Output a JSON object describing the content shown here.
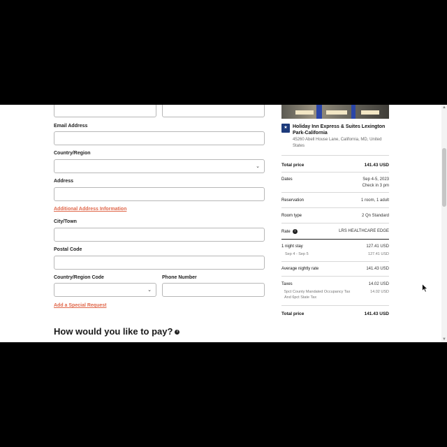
{
  "form": {
    "email_label": "Email Address",
    "country_label": "Country/Region",
    "address_label": "Address",
    "additional_address_link": "Additional Address Information",
    "city_label": "City/Town",
    "postal_label": "Postal Code",
    "country_code_label": "Country/Region Code",
    "phone_label": "Phone Number",
    "special_request_link": "Add a Special Request",
    "pay_heading": "How would you like to pay?",
    "accent_color": "#e0674a"
  },
  "summary": {
    "hotel_name": "Holiday Inn Express & Suites Lexington Park-California",
    "hotel_address": "45260 Abell House Lane, California, MD, United States",
    "total_price_label": "Total price",
    "total_price_value": "141.43 USD",
    "dates_label": "Dates",
    "dates_value": "Sep 4-5, 2023",
    "checkin_value": "Check in 3 pm",
    "reservation_label": "Reservation",
    "reservation_value": "1 room, 1 adult",
    "room_type_label": "Room type",
    "room_type_value": "2 Qn Standard",
    "rate_label": "Rate",
    "rate_value": "LRS HEALTHCARE EDGE",
    "stay_label": "1 night stay",
    "stay_value": "127.41 USD",
    "stay_dates_label": "Sep 4 - Sep 5",
    "stay_dates_value": "127.41 USD",
    "avg_rate_label": "Average nightly rate",
    "avg_rate_value": "141.43 USD",
    "taxes_label": "Taxes",
    "taxes_value": "14.02 USD",
    "tax_detail_line1": "5pct County Mandated Occupancy Tax",
    "tax_detail_line2": "And 6pct State Tax",
    "tax_detail_value": "14.02 USD",
    "grand_total_label": "Total price",
    "grand_total_value": "141.43 USD"
  },
  "icons": {
    "select_chevron": "chevron-down-icon",
    "info": "info-icon",
    "brand_logo": "hotel-brand-logo",
    "cursor": "mouse-cursor-icon"
  }
}
